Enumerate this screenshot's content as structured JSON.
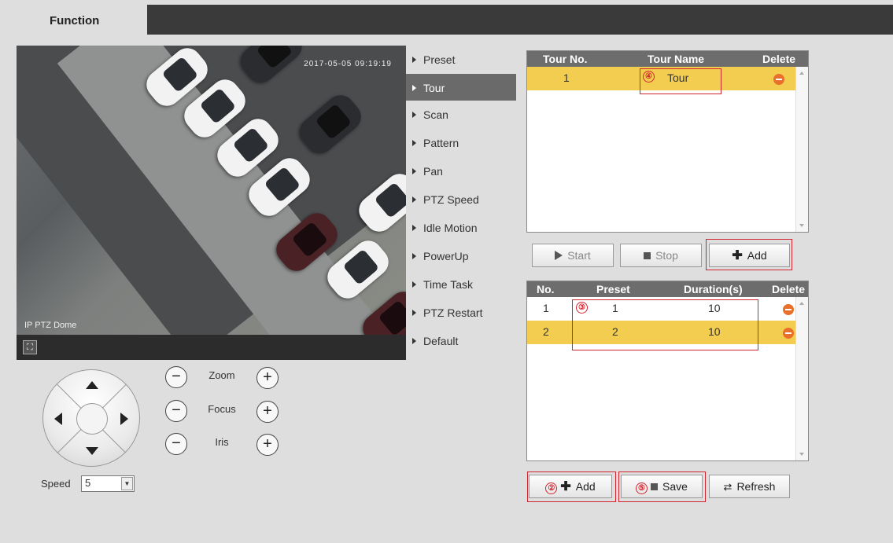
{
  "header": {
    "tab_label": "Function"
  },
  "video": {
    "timestamp": "2017-05-05 09:19:19",
    "overlay_text": "IP PTZ Dome"
  },
  "ptz": {
    "zoom_label": "Zoom",
    "focus_label": "Focus",
    "iris_label": "Iris",
    "minus_symbol": "−",
    "plus_symbol": "+",
    "speed_label": "Speed",
    "speed_value": "5"
  },
  "menu": {
    "items": [
      "Preset",
      "Tour",
      "Scan",
      "Pattern",
      "Pan",
      "PTZ Speed",
      "Idle Motion",
      "PowerUp",
      "Time Task",
      "PTZ Restart",
      "Default"
    ],
    "active": "Tour"
  },
  "tour_table": {
    "headers": {
      "no": "Tour No.",
      "name": "Tour Name",
      "delete": "Delete"
    },
    "rows": [
      {
        "no": "1",
        "name": "Tour"
      }
    ],
    "marker": "④"
  },
  "tour_buttons": {
    "start": "Start",
    "stop": "Stop",
    "add": "Add"
  },
  "preset_table": {
    "headers": {
      "no": "No.",
      "preset": "Preset",
      "duration": "Duration(s)",
      "delete": "Delete"
    },
    "rows": [
      {
        "no": "1",
        "preset": "1",
        "duration": "10"
      },
      {
        "no": "2",
        "preset": "2",
        "duration": "10"
      }
    ],
    "marker": "③"
  },
  "bottom_buttons": {
    "add": "Add",
    "add_marker": "②",
    "save": "Save",
    "save_marker": "⑤",
    "refresh": "Refresh"
  },
  "colors": {
    "selected_row": "#f3cd4f",
    "highlight_border": "#d1242e",
    "delete_icon": "#e8702a",
    "header_bg": "#6d6d6d",
    "topbar": "#3a3a3a"
  }
}
